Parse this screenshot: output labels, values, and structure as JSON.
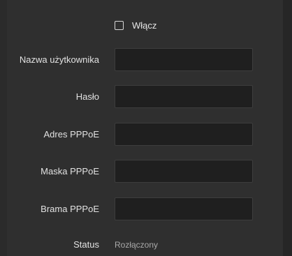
{
  "enable": {
    "label": "Włącz",
    "checked": false
  },
  "fields": {
    "username": {
      "label": "Nazwa użytkownika",
      "value": ""
    },
    "password": {
      "label": "Hasło",
      "value": ""
    },
    "address": {
      "label": "Adres PPPoE",
      "value": ""
    },
    "mask": {
      "label": "Maska PPPoE",
      "value": ""
    },
    "gateway": {
      "label": "Brama PPPoE",
      "value": ""
    }
  },
  "status": {
    "label": "Status",
    "value": "Rozłączony"
  },
  "colors": {
    "background": "#2f2f2f",
    "input_background": "#1f1f1f",
    "text": "#e2e2e2",
    "status_text": "#a9a9a9"
  }
}
